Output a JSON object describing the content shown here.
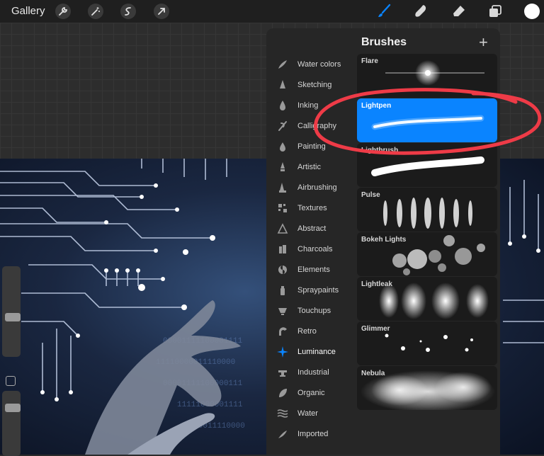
{
  "toolbar": {
    "gallery_label": "Gallery",
    "left_icons": [
      "wrench-icon",
      "magic-wand-icon",
      "selection-icon",
      "transform-arrow-icon"
    ],
    "right_icons": [
      "brush-icon",
      "smudge-icon",
      "eraser-icon",
      "layers-icon"
    ],
    "active_tool": "brush-icon",
    "accent_color": "#0a84ff",
    "current_color": "#ffffff"
  },
  "panel": {
    "title": "Brushes",
    "add_label": "+",
    "categories": [
      {
        "label": "Water colors",
        "icon": "water-colors-icon"
      },
      {
        "label": "Sketching",
        "icon": "sketching-icon"
      },
      {
        "label": "Inking",
        "icon": "inking-icon"
      },
      {
        "label": "Calligraphy",
        "icon": "calligraphy-icon"
      },
      {
        "label": "Painting",
        "icon": "painting-icon"
      },
      {
        "label": "Artistic",
        "icon": "artistic-icon"
      },
      {
        "label": "Airbrushing",
        "icon": "airbrushing-icon"
      },
      {
        "label": "Textures",
        "icon": "textures-icon"
      },
      {
        "label": "Abstract",
        "icon": "abstract-icon"
      },
      {
        "label": "Charcoals",
        "icon": "charcoals-icon"
      },
      {
        "label": "Elements",
        "icon": "elements-icon"
      },
      {
        "label": "Spraypaints",
        "icon": "spraypaints-icon"
      },
      {
        "label": "Touchups",
        "icon": "touchups-icon"
      },
      {
        "label": "Retro",
        "icon": "retro-icon"
      },
      {
        "label": "Luminance",
        "icon": "luminance-icon"
      },
      {
        "label": "Industrial",
        "icon": "industrial-icon"
      },
      {
        "label": "Organic",
        "icon": "organic-icon"
      },
      {
        "label": "Water",
        "icon": "water-icon"
      },
      {
        "label": "Imported",
        "icon": "imported-icon"
      }
    ],
    "active_category": "Luminance",
    "brushes": [
      {
        "name": "Flare"
      },
      {
        "name": "Lightpen"
      },
      {
        "name": "Lightbrush"
      },
      {
        "name": "Pulse"
      },
      {
        "name": "Bokeh Lights"
      },
      {
        "name": "Lightleak"
      },
      {
        "name": "Glimmer"
      },
      {
        "name": "Nebula"
      }
    ],
    "selected_brush": "Lightpen"
  }
}
